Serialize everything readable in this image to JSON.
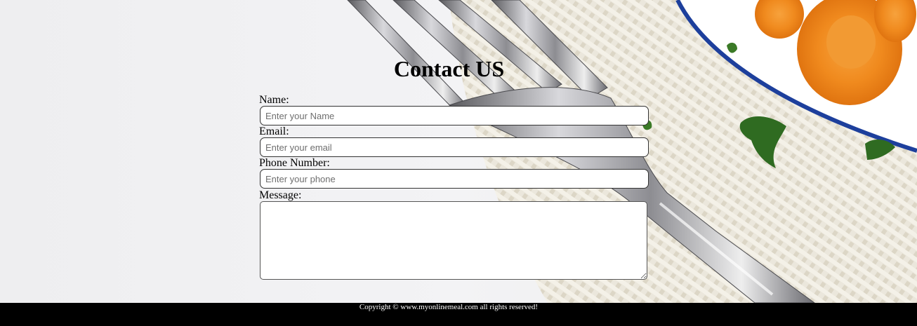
{
  "page": {
    "title": "Contact US"
  },
  "form": {
    "name_label": "Name:",
    "name_placeholder": "Enter your Name",
    "name_value": "",
    "email_label": "Email:",
    "email_placeholder": "Enter your email",
    "email_value": "",
    "phone_label": "Phone Number:",
    "phone_placeholder": "Enter your phone",
    "phone_value": "",
    "message_label": "Message:",
    "message_value": ""
  },
  "footer": {
    "copyright": "Copyright © www.myonlinemeal.com all rights reserved!"
  },
  "colors": {
    "footer_bg": "#000000",
    "footer_text": "#ffffff",
    "background": "#f1f1f3"
  },
  "background_image": {
    "description_icon": "fork-plate-carrots-photo"
  }
}
